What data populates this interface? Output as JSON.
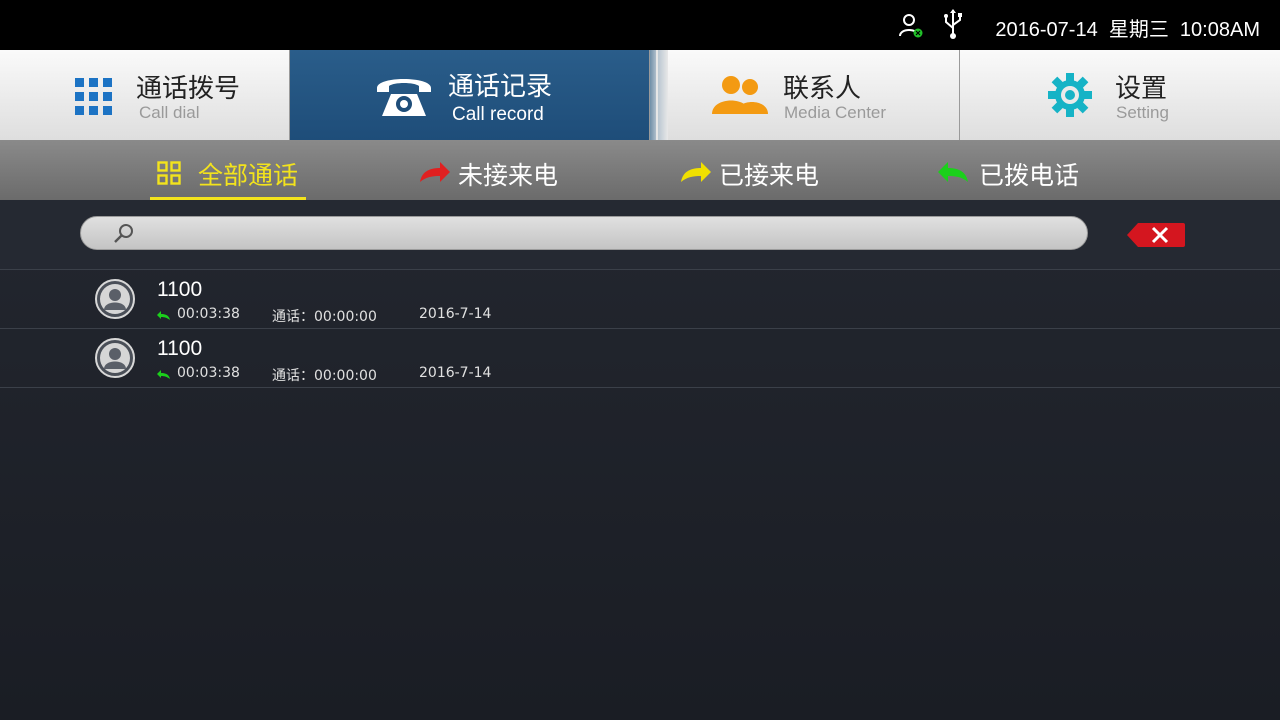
{
  "status_bar": {
    "datetime": "2016-07-14  星期三  10:08AM",
    "icons": [
      "user-status-icon",
      "usb-icon"
    ]
  },
  "nav": {
    "tabs": [
      {
        "title": "通话拨号",
        "subtitle": "Call dial",
        "icon": "dialpad-icon"
      },
      {
        "title": "通话记录",
        "subtitle": "Call record",
        "icon": "telephone-icon",
        "active": true
      },
      {
        "title": "联系人",
        "subtitle": "Media Center",
        "icon": "contacts-icon"
      },
      {
        "title": "设置",
        "subtitle": "Setting",
        "icon": "gear-icon"
      }
    ]
  },
  "filters": [
    {
      "label": "全部通话",
      "icon": "grid-icon",
      "active": true
    },
    {
      "label": "未接来电",
      "icon": "missed-call-arrow-icon",
      "color": "#e02020"
    },
    {
      "label": "已接来电",
      "icon": "received-call-arrow-icon",
      "color": "#f0e000"
    },
    {
      "label": "已拨电话",
      "icon": "dialed-call-arrow-icon",
      "color": "#1bd01b"
    }
  ],
  "search": {
    "value": "",
    "placeholder": ""
  },
  "records": [
    {
      "number": "1100",
      "time": "00:03:38",
      "duration_label": "通话：00:00:00",
      "date": "2016-7-14"
    },
    {
      "number": "1100",
      "time": "00:03:38",
      "duration_label": "通话：00:00:00",
      "date": "2016-7-14"
    }
  ],
  "colors": {
    "accent_active": "#1e4d79",
    "filter_active": "#f3e31c",
    "clear_button": "#d4161f",
    "contacts_icon": "#f39a12",
    "settings_icon": "#16b3c6",
    "dialpad_icon": "#1c73c4"
  }
}
